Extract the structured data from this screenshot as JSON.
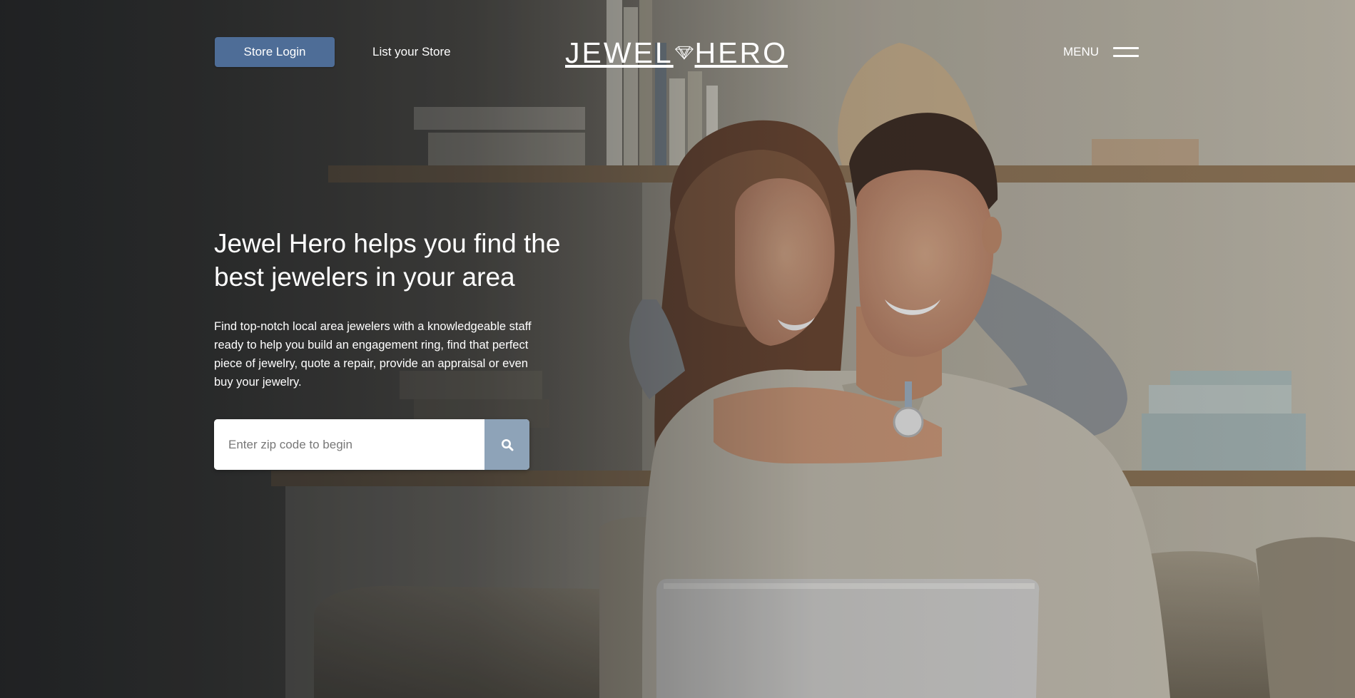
{
  "header": {
    "store_login_label": "Store Login",
    "list_store_label": "List your Store",
    "logo": {
      "left": "JEWEL",
      "right": "HERO"
    },
    "menu_label": "MENU"
  },
  "hero": {
    "headline": "Jewel Hero helps you find the best jewelers in your area",
    "description": "Find top-notch local area jewelers with a knowledgeable staff ready to help you build an engagement ring, find that perfect piece of jewelry, quote a repair, provide an appraisal or even buy your jewelry."
  },
  "search": {
    "placeholder": "Enter zip code to begin",
    "value": "",
    "button_icon": "search-icon"
  },
  "colors": {
    "store_login_bg": "#4e6d97",
    "search_button_bg": "#8ea3b8",
    "text": "#ffffff"
  }
}
